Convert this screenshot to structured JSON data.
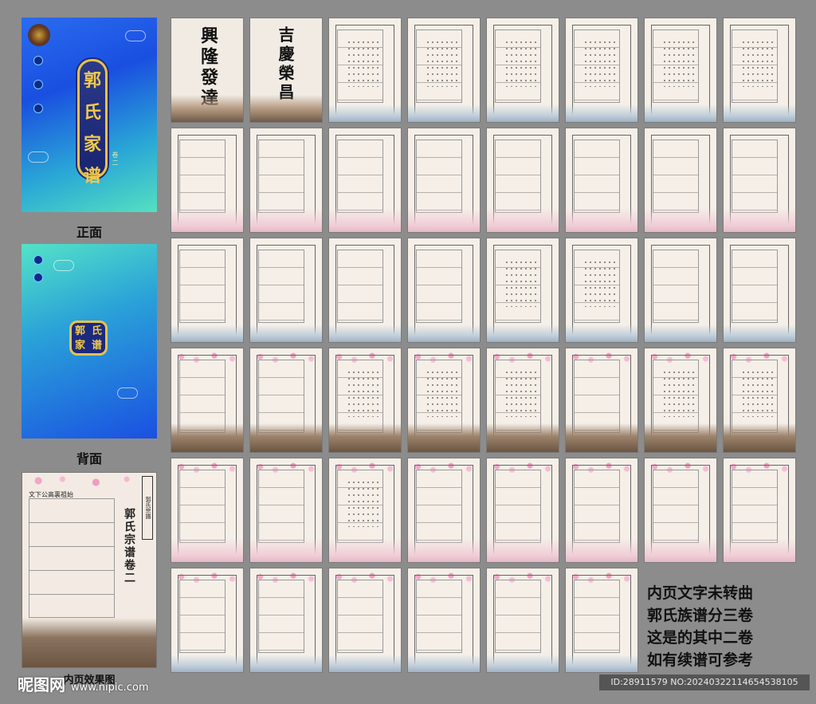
{
  "covers": {
    "front_title": [
      "郭",
      "氏",
      "家",
      "谱"
    ],
    "front_volume": "卷二",
    "front_caption": "正面",
    "back_title": [
      "郭",
      "氏",
      "家",
      "谱"
    ],
    "back_caption": "背面",
    "sample_caption": "内页效果图",
    "sample_header": "文下公高裏祖始",
    "sample_band": "郭氏宗譜",
    "sample_heading": "郭氏宗谱卷二"
  },
  "pages": {
    "calligraphy_1": "興隆發達",
    "calligraphy_2": "吉慶榮昌",
    "generic_tag": "郭氏宗譜"
  },
  "note": {
    "lines": [
      "内页文字未转曲",
      "郭氏族谱分三卷",
      "这是的其中二卷",
      "如有续谱可参考"
    ]
  },
  "watermarks": {
    "left": "昵图网",
    "left_url": "www.nipic.com",
    "right": "ID:28911579 NO:20240322114654538105"
  },
  "colors": {
    "cover_blue": "#1a4fe0",
    "cover_teal": "#55e0c0",
    "plaque_gold": "#e8c24a",
    "page_bg": "#f5efe8",
    "background": "#8c8c8c"
  }
}
